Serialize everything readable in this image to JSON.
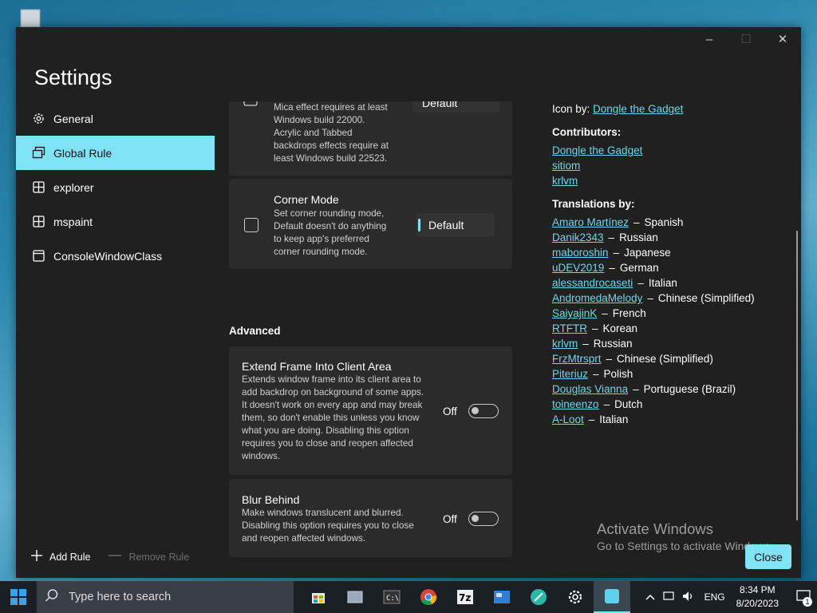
{
  "window": {
    "title": "Settings"
  },
  "titlebar": {
    "minimize": "–",
    "maximize": "☐",
    "close": "✕"
  },
  "nav": [
    {
      "label": "General",
      "icon": "gear-icon"
    },
    {
      "label": "Global Rule",
      "icon": "windows-icon",
      "active": true
    },
    {
      "label": "explorer",
      "icon": "window-grid-icon"
    },
    {
      "label": "mspaint",
      "icon": "window-grid-icon"
    },
    {
      "label": "ConsoleWindowClass",
      "icon": "window-icon"
    }
  ],
  "actions": {
    "add": "Add Rule",
    "remove": "Remove Rule"
  },
  "backdrop_card": {
    "desc_lines": [
      "Mica effect requires at least",
      "Windows build 22000.",
      "Acrylic and Tabbed",
      "backdrops effects require at",
      "least Windows build 22523."
    ],
    "value": "Default"
  },
  "corner_card": {
    "title": "Corner Mode",
    "desc_lines": [
      "Set corner rounding mode,",
      "Default doesn't do anything",
      "to keep app's preferred",
      "corner rounding mode."
    ],
    "value": "Default"
  },
  "advanced": {
    "heading": "Advanced"
  },
  "extend_card": {
    "title": "Extend Frame Into Client Area",
    "desc_lines": [
      "Extends window frame into its client area to",
      "add backdrop on background of some apps.",
      "It doesn't work on every app and may break",
      "them, so don't enable this unless you know",
      "what you are doing. Disabling this option",
      "requires you to close and reopen affected",
      "windows."
    ],
    "state": "Off"
  },
  "blur_card": {
    "title": "Blur Behind",
    "desc_lines": [
      "Make windows translucent and blurred.",
      "Disabling this option requires you to close",
      "and reopen affected windows."
    ],
    "state": "Off"
  },
  "about": {
    "icon_by_label": "Icon by:",
    "icon_by_name": "Dongle the Gadget",
    "contributors_label": "Contributors:",
    "contributors": [
      "Dongle the Gadget",
      "sitiom",
      "krlvm"
    ],
    "translations_label": "Translations by:",
    "translations": [
      {
        "name": "Amaro Martínez",
        "lang": "Spanish"
      },
      {
        "name": "Danik2343",
        "lang": "Russian"
      },
      {
        "name": "maboroshin",
        "lang": "Japanese"
      },
      {
        "name": "uDEV2019",
        "lang": "German"
      },
      {
        "name": "alessandrocaseti",
        "lang": "Italian"
      },
      {
        "name": "AndromedaMelody",
        "lang": "Chinese (Simplified)"
      },
      {
        "name": "SaiyajinK",
        "lang": "French"
      },
      {
        "name": "RTFTR",
        "lang": "Korean"
      },
      {
        "name": "krlvm",
        "lang": "Russian"
      },
      {
        "name": "FrzMtrsprt",
        "lang": "Chinese (Simplified)"
      },
      {
        "name": "Piteriuz",
        "lang": "Polish"
      },
      {
        "name": "Douglas Vianna",
        "lang": "Portuguese (Brazil)"
      },
      {
        "name": "toineenzo",
        "lang": "Dutch"
      },
      {
        "name": "A-Loot",
        "lang": "Italian"
      }
    ],
    "dash": "–"
  },
  "watermark": {
    "line1": "Activate Windows",
    "line2": "Go to Settings to activate Windows."
  },
  "close_button": "Close",
  "taskbar": {
    "search_placeholder": "Type here to search",
    "lang": "ENG",
    "time": "8:34 PM",
    "date": "8/20/2023",
    "notification_count": "1"
  },
  "colors": {
    "accent": "#7fe3f5",
    "link": "#6fd5e8",
    "bg": "#202020",
    "card": "#2b2b2b"
  }
}
